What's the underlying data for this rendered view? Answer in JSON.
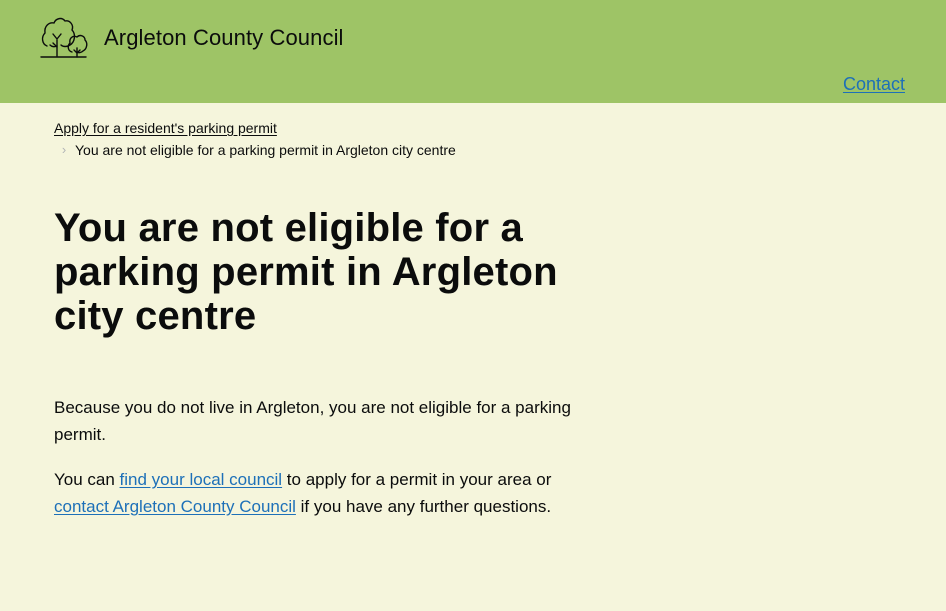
{
  "header": {
    "site_name": "Argleton County Council",
    "logo_icon": "trees-icon",
    "nav": {
      "contact_label": "Contact"
    }
  },
  "breadcrumbs": [
    {
      "label": "Apply for a resident's parking permit",
      "is_link": true
    },
    {
      "label": "You are not eligible for a parking permit in Argleton city centre",
      "is_link": false
    }
  ],
  "page": {
    "heading": "You are not eligible for a parking permit in Argleton city centre",
    "paragraph_1": "Because you do not live in Argleton, you are not eligible for a parking permit.",
    "paragraph_2": {
      "text_1": "You can ",
      "link_1": "find your local council",
      "text_2": " to apply for a permit in your area or ",
      "link_2": "contact Argleton County Council",
      "text_3": " if you have any further questions."
    }
  },
  "colors": {
    "header_background": "#9ec466",
    "page_background": "#f5f5dc",
    "link": "#1d70b8",
    "text": "#0b0c0c"
  }
}
